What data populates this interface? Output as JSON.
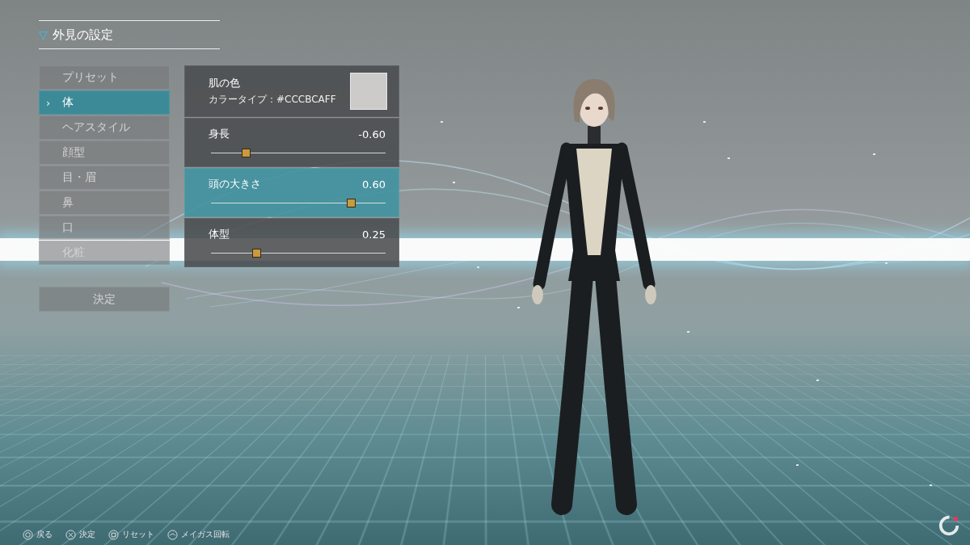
{
  "header": {
    "icon": "▽",
    "title": "外見の設定"
  },
  "menu": {
    "cursor": "›",
    "items": [
      {
        "label": "プリセット",
        "selected": false
      },
      {
        "label": "体",
        "selected": true
      },
      {
        "label": "ヘアスタイル",
        "selected": false
      },
      {
        "label": "顔型",
        "selected": false
      },
      {
        "label": "目・眉",
        "selected": false
      },
      {
        "label": "鼻",
        "selected": false
      },
      {
        "label": "口",
        "selected": false
      },
      {
        "label": "化粧",
        "selected": false
      }
    ],
    "confirm": "決定"
  },
  "settings": {
    "color": {
      "label": "肌の色",
      "type_label": "カラータイプ：",
      "value": "#CCCBCAFF",
      "selected": false
    },
    "sliders": [
      {
        "label": "身長",
        "reading": "-0.60",
        "level": 0.2,
        "selected": false
      },
      {
        "label": "頭の大きさ",
        "reading": "0.60",
        "level": 0.8,
        "selected": true
      },
      {
        "label": "体型",
        "reading": "0.25",
        "level": 0.26,
        "selected": false
      }
    ]
  },
  "hints": [
    {
      "kind": "circle",
      "label": "戻る"
    },
    {
      "kind": "cross",
      "label": "決定"
    },
    {
      "kind": "square",
      "label": "リセット"
    },
    {
      "kind": "stick",
      "label": "メイガス回転"
    }
  ]
}
